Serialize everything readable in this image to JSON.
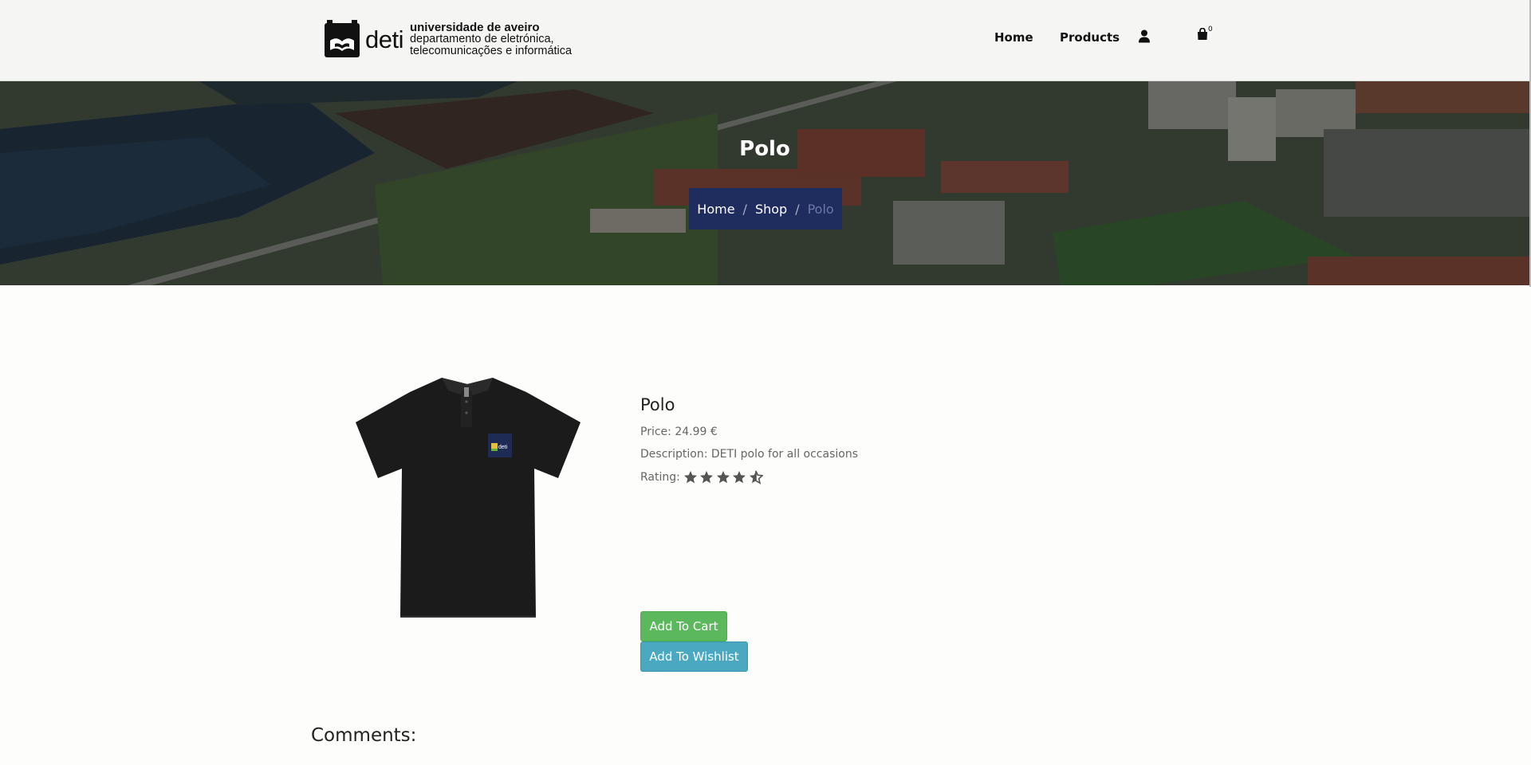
{
  "header": {
    "logo": {
      "brand": "deti",
      "line1": "universidade de aveiro",
      "line2": "departamento de eletrónica,",
      "line3": "telecomunicações e informática"
    },
    "nav": {
      "home": "Home",
      "products": "Products",
      "cart_count": "0"
    }
  },
  "hero": {
    "title": "Polo",
    "breadcrumb": {
      "home": "Home",
      "shop": "Shop",
      "current": "Polo",
      "separator": "/"
    }
  },
  "product": {
    "name": "Polo",
    "price_label": "Price:",
    "price": "24.99 €",
    "description_label": "Description:",
    "description": "DETI polo for all occasions",
    "rating_label": "Rating:",
    "rating": 4.5,
    "rating_max": 5
  },
  "actions": {
    "add_to_cart": "Add To Cart",
    "add_to_wishlist": "Add To Wishlist"
  },
  "comments": {
    "title": "Comments:"
  },
  "colors": {
    "breadcrumb_bg": "#1f2d5e",
    "add_to_cart_bg": "#5cb85c",
    "add_to_wishlist_bg": "#4aa9c0"
  }
}
